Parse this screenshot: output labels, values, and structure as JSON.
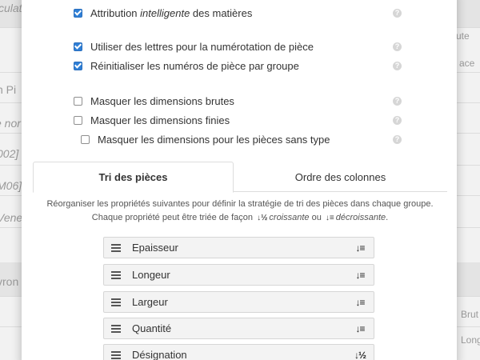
{
  "background": {
    "left_fragments": [
      "culat",
      "n Pi",
      "e nor",
      "002]",
      "M06]",
      "Vene",
      "vron"
    ],
    "right_fragments": [
      "ute",
      "ace",
      "Brut",
      "Long"
    ]
  },
  "options": [
    {
      "label_before": "Attribution ",
      "label_em": "intelligente",
      "label_after": " des matières",
      "checked": true
    },
    {
      "label_before": "Utiliser des lettres pour la numérotation de pièce",
      "label_em": "",
      "label_after": "",
      "checked": true
    },
    {
      "label_before": "Réinitialiser les numéros de pièce par groupe",
      "label_em": "",
      "label_after": "",
      "checked": true
    },
    {
      "label_before": "Masquer les dimensions brutes",
      "label_em": "",
      "label_after": "",
      "checked": false
    },
    {
      "label_before": "Masquer les dimensions finies",
      "label_em": "",
      "label_after": "",
      "checked": false
    },
    {
      "label_before": "Masquer les dimensions pour les pièces sans type",
      "label_em": "",
      "label_after": "",
      "checked": false
    }
  ],
  "help_glyph": "?",
  "tabs": {
    "sort": "Tri des pièces",
    "columns": "Ordre des colonnes"
  },
  "description": {
    "line1": "Réorganiser les propriétés suivantes pour définir la stratégie de tri des pièces dans chaque groupe.",
    "line2_start": "Chaque propriété peut être triée de façon",
    "asc_icon": "↓½",
    "asc_label": "croissante",
    "or": "ou",
    "desc_icon": "↓≡",
    "desc_label": "décroissante",
    "end": "."
  },
  "sort_items": [
    {
      "label": "Epaisseur",
      "direction": "descending",
      "icon": "↓≡"
    },
    {
      "label": "Longeur",
      "direction": "descending",
      "icon": "↓≡"
    },
    {
      "label": "Largeur",
      "direction": "descending",
      "icon": "↓≡"
    },
    {
      "label": "Quantité",
      "direction": "descending",
      "icon": "↓≡"
    },
    {
      "label": "Désignation",
      "direction": "ascending",
      "icon": "↓½"
    }
  ],
  "colors": {
    "checkbox_on": "#2f7fd6",
    "modal_bg": "#ffffff",
    "item_bg": "#f3f3f3"
  }
}
